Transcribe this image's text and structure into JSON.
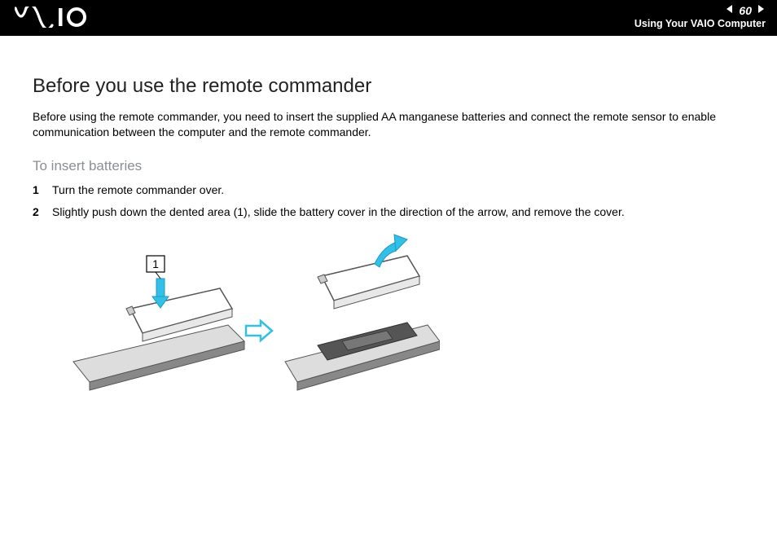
{
  "header": {
    "logo_alt": "VAIO",
    "page_number": "60",
    "section": "Using Your VAIO Computer"
  },
  "content": {
    "heading": "Before you use the remote commander",
    "intro": "Before using the remote commander, you need to insert the supplied AA manganese batteries and connect the remote sensor to enable communication between the computer and the remote commander.",
    "subheading": "To insert batteries",
    "steps": [
      {
        "num": "1",
        "text": "Turn the remote commander over."
      },
      {
        "num": "2",
        "text": "Slightly push down the dented area (1), slide the battery cover in the direction of the arrow, and remove the cover."
      }
    ],
    "callout_label": "1"
  }
}
